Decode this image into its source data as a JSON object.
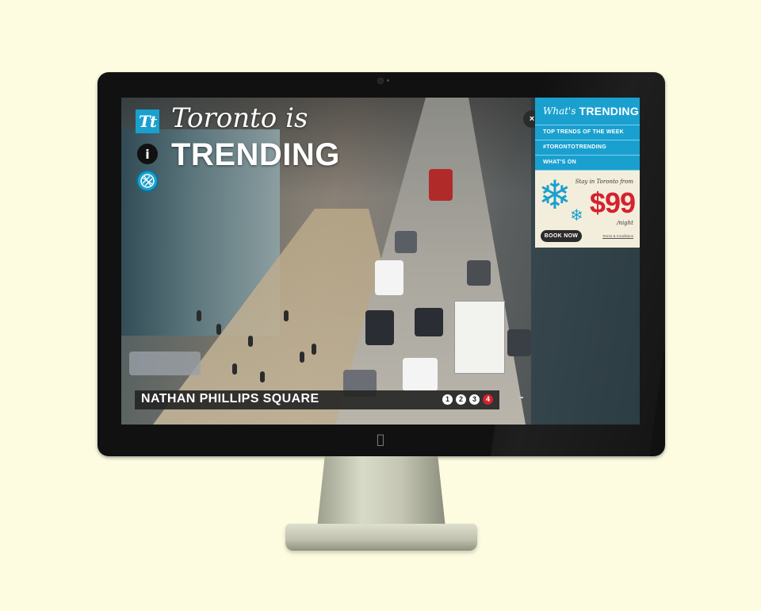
{
  "site": {
    "logo_text": "Tt",
    "title_line1": "Toronto is",
    "title_line2": "TRENDING"
  },
  "slider": {
    "location": "NATHAN PHILLIPS SQUARE",
    "pages": [
      "1",
      "2",
      "3",
      "4"
    ],
    "active_page": 4
  },
  "panel": {
    "header_italic": "What's",
    "header_bold": "TRENDING",
    "close_label": "×",
    "items": [
      {
        "label": "TOP TRENDS OF THE WEEK"
      },
      {
        "label": "#TORONTOTRENDING"
      },
      {
        "label": "WHAT'S ON"
      }
    ],
    "promo": {
      "subtitle": "Stay in Toronto from",
      "price": "$99",
      "unit": "/night",
      "button": "BOOK NOW",
      "terms": "Terms & Conditions"
    }
  },
  "colors": {
    "accent": "#1aa0cf",
    "price": "#d6212e",
    "background": "#fdfbe0"
  },
  "icons": {
    "info": "info-icon",
    "map": "map-icon",
    "snowflake": "snowflake-icon",
    "apple": "apple-logo-icon",
    "close": "close-icon"
  }
}
